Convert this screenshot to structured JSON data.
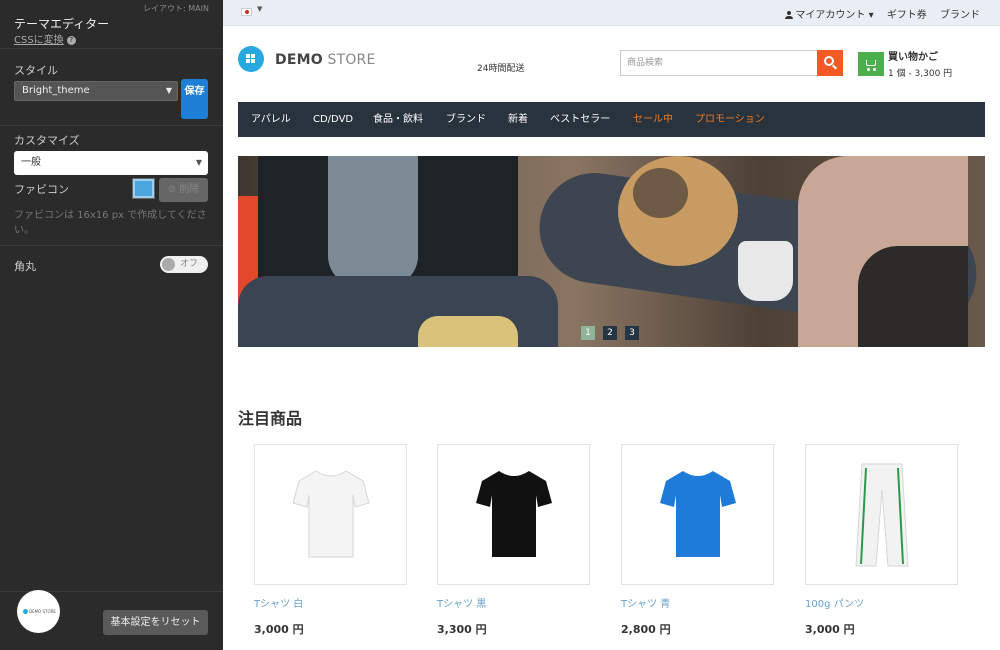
{
  "editor": {
    "layout_label": "レイアウト: MAIN",
    "title": "テーマエディター",
    "css_link": "CSSに変換",
    "style_label": "スタイル",
    "style_value": "Bright_theme",
    "save_label": "保存",
    "customize_label": "カスタマイズ",
    "customize_value": "一般",
    "favicon_label": "ファビコン",
    "delete_label": "削除",
    "favicon_hint": "ファビコンは 16x16 px で作成してください。",
    "rounded_label": "角丸",
    "toggle_value": "オフ",
    "toggle_on": false,
    "badge_text": "DEMO STORE",
    "reset_label": "基本設定をリセット"
  },
  "store": {
    "top_links": {
      "account": "マイアカウント",
      "gift": "ギフト券",
      "brand": "ブランド"
    },
    "logo": {
      "part1": "DEMO",
      "part2": " STORE"
    },
    "delivery": "24時間配送",
    "search_placeholder": "商品検索",
    "cart": {
      "title": "買い物かご",
      "summary": "1 個 - 3,300 円"
    },
    "nav": [
      {
        "label": "アパレル"
      },
      {
        "label": "CD/DVD"
      },
      {
        "label": "食品・飲料"
      },
      {
        "label": "ブランド"
      },
      {
        "label": "新着"
      },
      {
        "label": "ベストセラー"
      },
      {
        "label": "セール中"
      },
      {
        "label": "プロモーション"
      }
    ],
    "slider": {
      "pages": [
        "1",
        "2",
        "3"
      ],
      "active": "1"
    },
    "featured_title": "注目商品",
    "products": [
      {
        "name": "Tシャツ 白",
        "price": "3,000 円",
        "color": "#f4f4f4"
      },
      {
        "name": "Tシャツ 黒",
        "price": "3,300 円",
        "color": "#111111"
      },
      {
        "name": "Tシャツ 青",
        "price": "2,800 円",
        "color": "#1e7bd8"
      },
      {
        "name": "100g パンツ",
        "price": "3,000 円",
        "color": "#f2f2f2"
      }
    ]
  },
  "colors": {
    "accent": "#1e7fd6",
    "search": "#f15a24",
    "cart": "#4cae4c",
    "nav_bg": "#28333d",
    "nav_highlight": "#f47b20"
  },
  "icons": [
    "help-icon",
    "chevron-down-icon",
    "collapse-left-icon",
    "flag-japan-icon",
    "user-icon",
    "search-icon",
    "cart-icon",
    "logo-icon"
  ]
}
